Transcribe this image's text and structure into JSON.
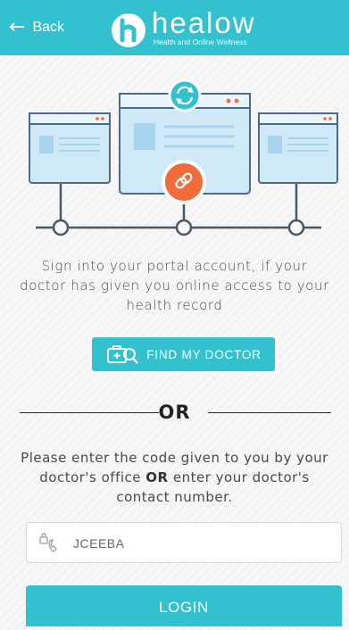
{
  "header": {
    "back_label": "Back",
    "brand_name": "healow",
    "brand_tagline": "Health and Online Wellness"
  },
  "intro_text": "Sign into your portal account, if your doctor has given you online access to your health record",
  "find_button": {
    "label": "FIND MY DOCTOR"
  },
  "divider": {
    "label": "OR"
  },
  "code_instructions": {
    "part1": "Please enter the code given to you by your doctor's office ",
    "emphasis": "OR",
    "part2": " enter your doctor's contact number."
  },
  "code_field": {
    "value": "JCEEBA"
  },
  "login_button": {
    "label": "LOGIN"
  },
  "colors": {
    "accent": "#34c1cf",
    "link_orange": "#f26b3a",
    "screen_blue": "#cfe9f7",
    "screen_border": "#4b6b8c"
  },
  "icons": {
    "back": "arrow-left-icon",
    "brand": "healow-logo-icon",
    "sync": "refresh-icon",
    "link": "link-icon",
    "doctor": "doctor-bag-search-icon",
    "field": "phone-lock-icon"
  }
}
